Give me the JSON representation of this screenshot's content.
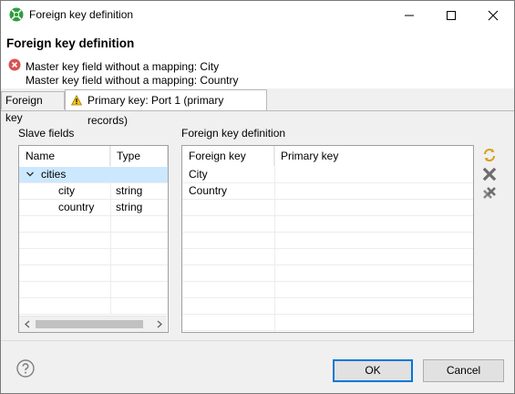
{
  "window": {
    "title": "Foreign key definition",
    "controls": {
      "minimize": "—",
      "maximize": "☐",
      "close": "✕"
    }
  },
  "header": {
    "title": "Foreign key definition",
    "messages": [
      "Master key field without a mapping: City",
      "Master key field without a mapping: Country"
    ]
  },
  "tabs": [
    {
      "label": "Foreign key"
    },
    {
      "label": "Primary key: Port 1 (primary records)"
    }
  ],
  "slave": {
    "group_label": "Slave fields",
    "columns": [
      "Name",
      "Type"
    ],
    "root": "cities",
    "rows": [
      {
        "name": "city",
        "type": "string"
      },
      {
        "name": "country",
        "type": "string"
      }
    ]
  },
  "fk": {
    "group_label": "Foreign key definition",
    "columns": [
      "Foreign key",
      "Primary key"
    ],
    "rows": [
      {
        "foreign": "City",
        "primary": ""
      },
      {
        "foreign": "Country",
        "primary": ""
      }
    ]
  },
  "footer": {
    "ok": "OK",
    "cancel": "Cancel"
  },
  "colors": {
    "selection": "#cce8ff",
    "accent": "#0078d7",
    "error": "#d9534f"
  }
}
